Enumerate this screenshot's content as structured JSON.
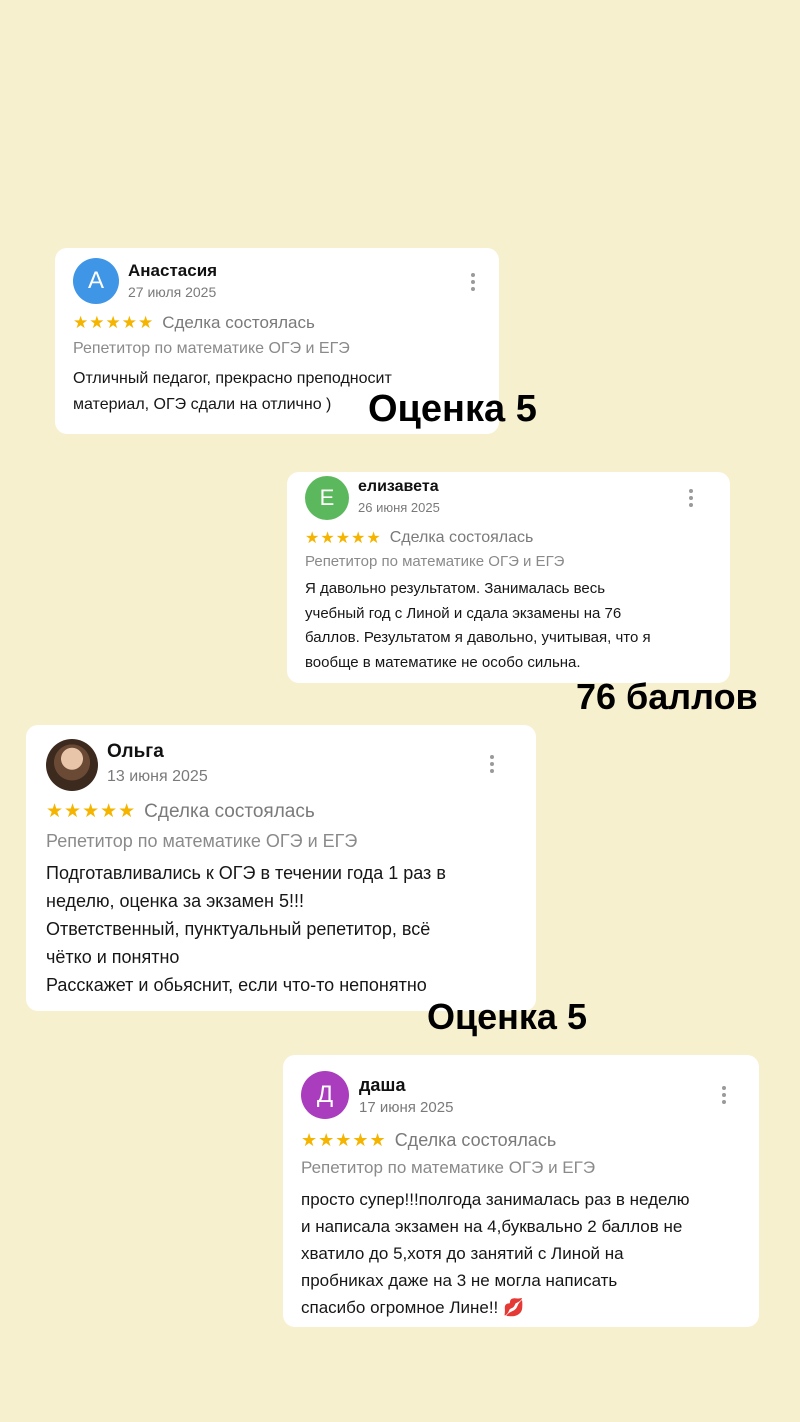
{
  "reviews": [
    {
      "avatar_letter": "А",
      "avatar_color": "#3f95e6",
      "name": "Анастасия",
      "date": "27 июля 2025",
      "stars": "★★★★★",
      "deal": "Сделка состоялась",
      "service": "Репетитор по математике ОГЭ и ЕГЭ",
      "text_lines": [
        "Отличный педагог, прекрасно преподносит",
        "материал, ОГЭ сдали на отлично )"
      ]
    },
    {
      "avatar_letter": "Е",
      "avatar_color": "#5cb85c",
      "name": "елизавета",
      "date": "26 июня 2025",
      "stars": "★★★★★",
      "deal": "Сделка состоялась",
      "service": "Репетитор по математике ОГЭ и ЕГЭ",
      "text_lines": [
        "Я давольно результатом. Занималась весь",
        "учебный год с Линой и сдала экзамены на 76",
        "баллов. Результатом я давольно, учитывая, что я",
        "вообще в математике не особо сильна."
      ]
    },
    {
      "avatar_letter": "",
      "avatar_color": "#5a3e2b",
      "name": "Ольга",
      "date": "13 июня 2025",
      "stars": "★★★★★",
      "deal": "Сделка состоялась",
      "service": "Репетитор по математике ОГЭ и ЕГЭ",
      "text_lines": [
        "Подготавливались к ОГЭ в течении года 1 раз в",
        "неделю,  оценка за экзамен 5!!!",
        "Ответственный, пунктуальный репетитор, всё",
        "чётко и понятно",
        "Расскажет и обьяснит, если что-то непонятно"
      ]
    },
    {
      "avatar_letter": "Д",
      "avatar_color": "#a93dbd",
      "name": "даша",
      "date": "17 июня 2025",
      "stars": "★★★★★",
      "deal": "Сделка состоялась",
      "service": "Репетитор по математике ОГЭ и ЕГЭ",
      "text_lines": [
        "просто супер!!!полгода занималась раз в неделю",
        "и написала экзамен на 4,буквально 2 баллов не",
        "хватило до 5,хотя до занятий с Линой на",
        "пробниках даже на 3 не могла написать",
        "спасибо огромное Лине!! 💋"
      ]
    }
  ],
  "captions": [
    "Оценка 5",
    "76 баллов",
    "Оценка 5"
  ]
}
